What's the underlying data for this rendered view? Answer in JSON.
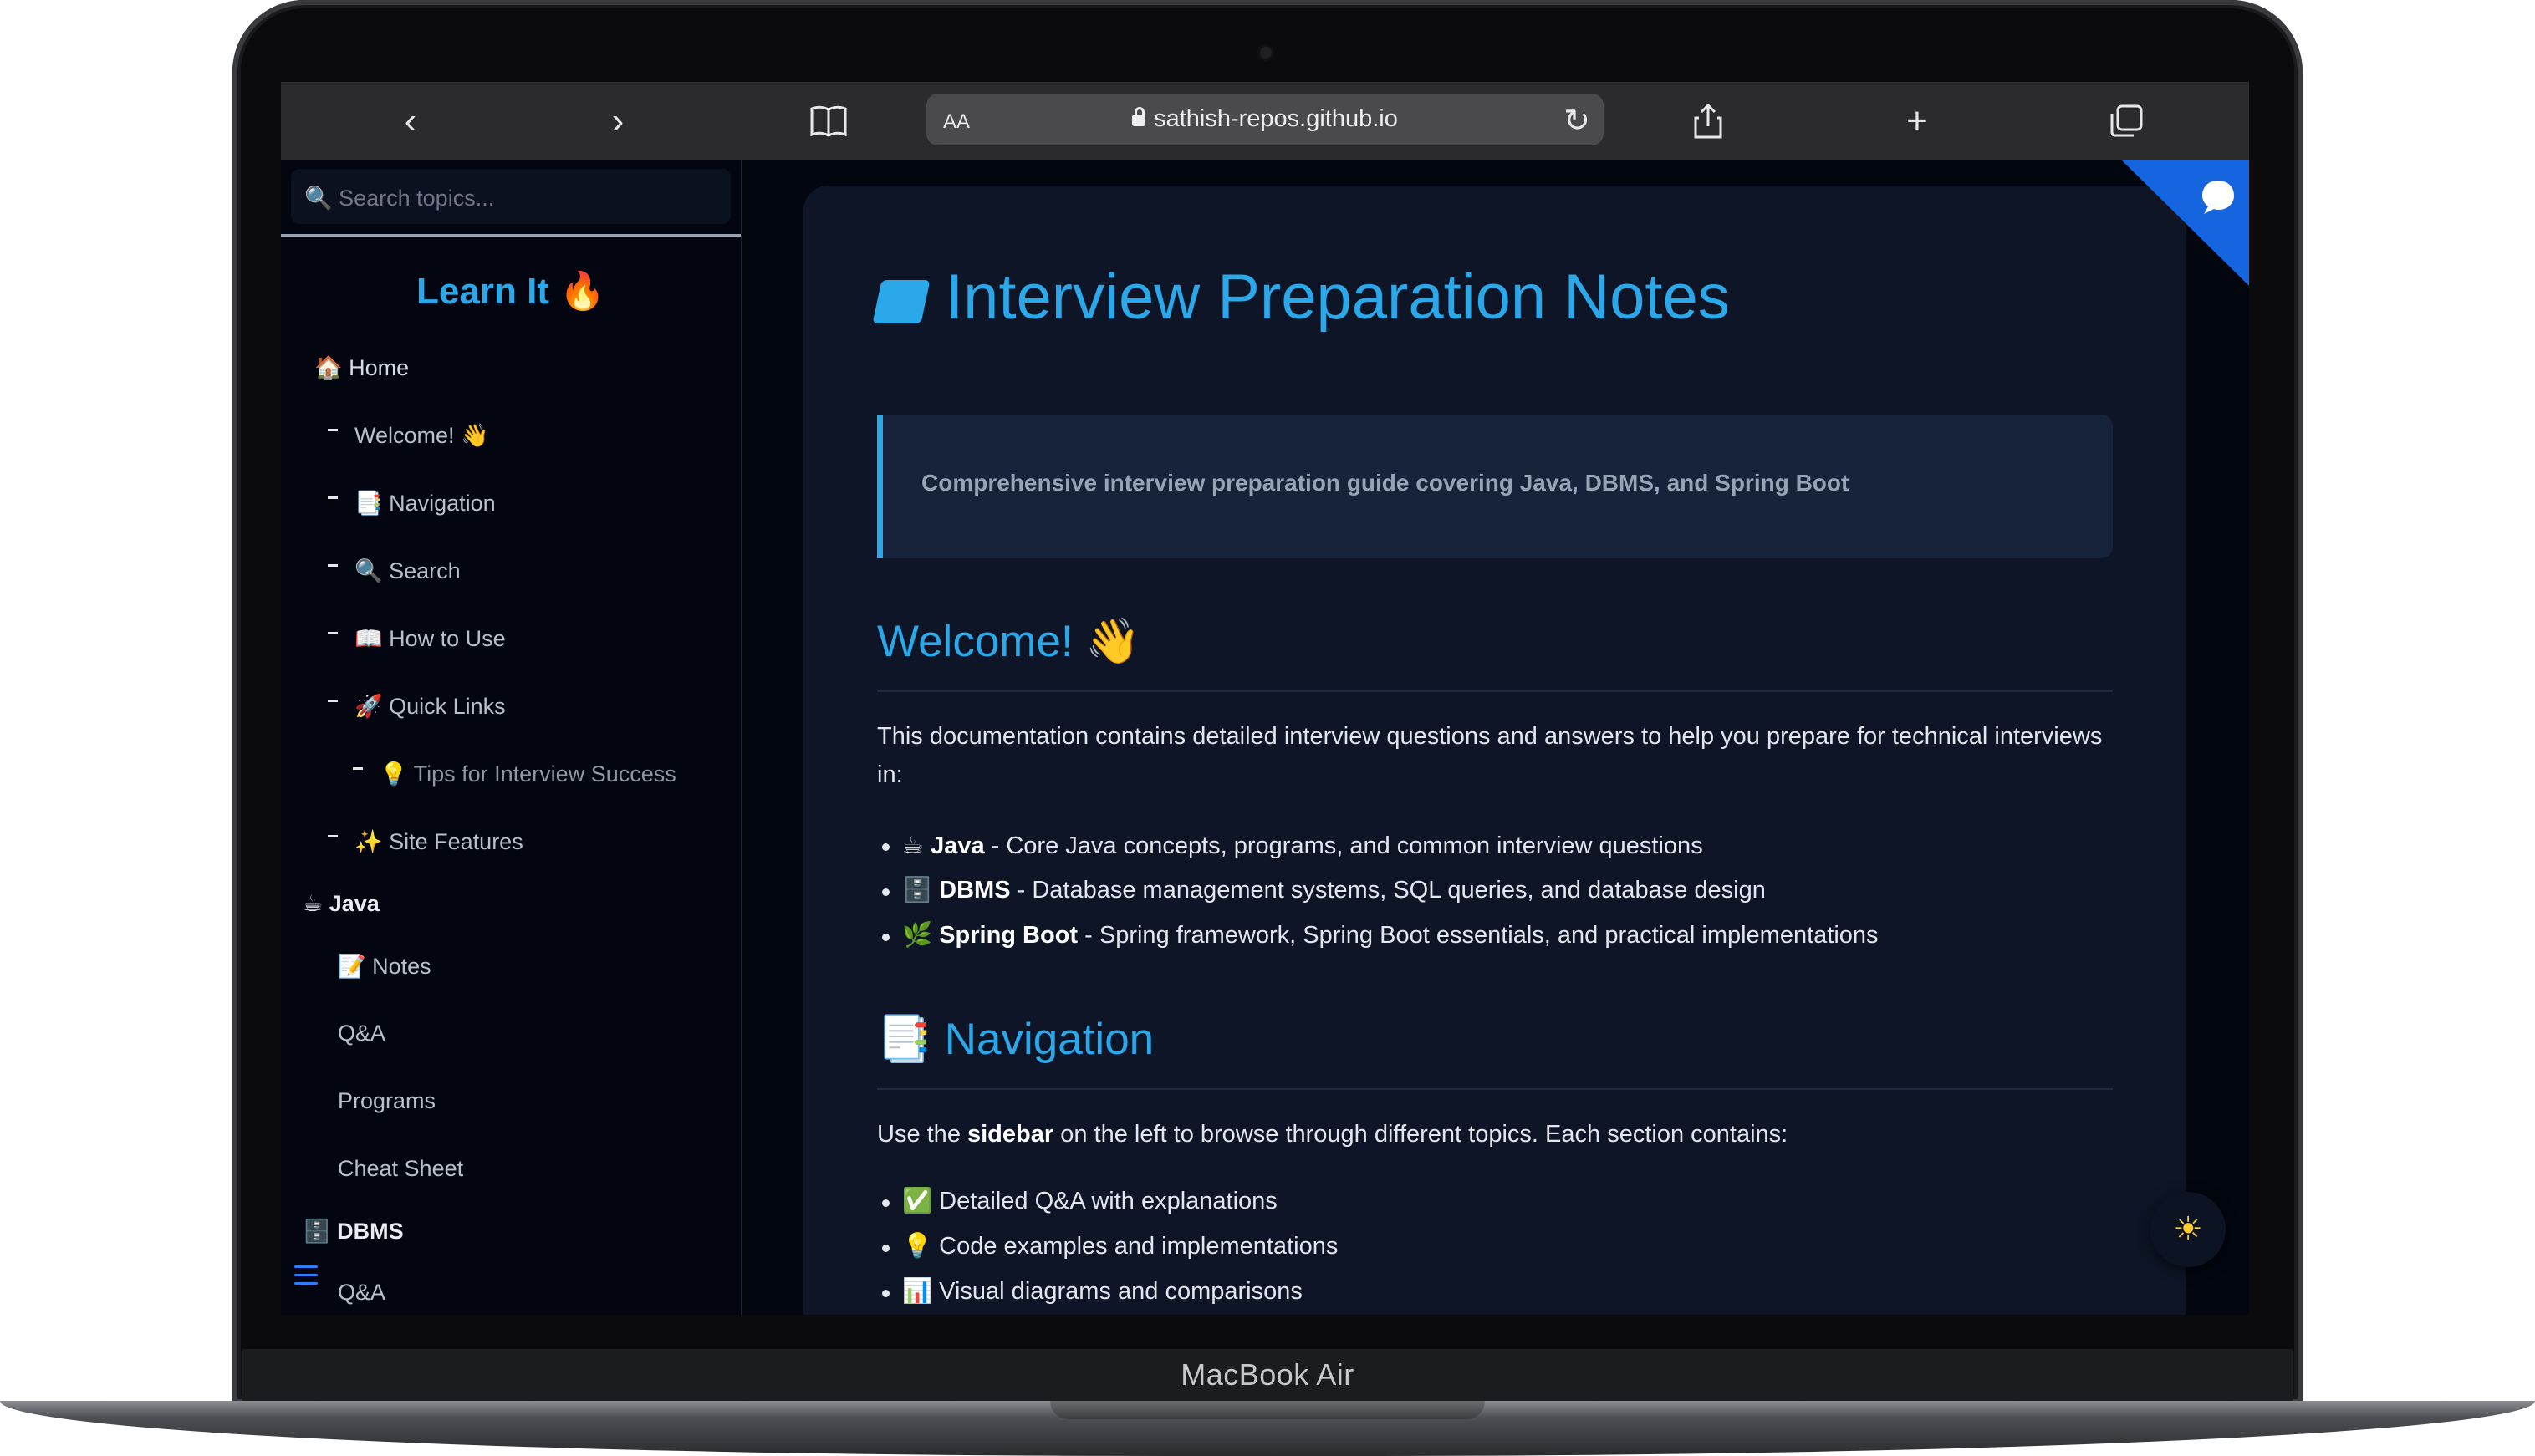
{
  "device": {
    "model_label": "MacBook Air"
  },
  "browser": {
    "text_size_label": "AA",
    "url": "sathish-repos.github.io"
  },
  "sidebar": {
    "search_placeholder": "🔍 Search topics...",
    "brand": "Learn It 🔥",
    "items": [
      {
        "label": "🏠 Home"
      },
      {
        "label": "Welcome! 👋"
      },
      {
        "label": "📑 Navigation"
      },
      {
        "label": "🔍 Search"
      },
      {
        "label": "📖 How to Use"
      },
      {
        "label": "🚀 Quick Links"
      },
      {
        "label": "💡 Tips for Interview Success"
      },
      {
        "label": "✨ Site Features"
      },
      {
        "label": "☕ Java"
      },
      {
        "label": "📝 Notes"
      },
      {
        "label": "Q&A"
      },
      {
        "label": "Programs"
      },
      {
        "label": "Cheat Sheet"
      },
      {
        "label": "🗄️ DBMS"
      },
      {
        "label": "Q&A"
      }
    ]
  },
  "main": {
    "title": "Interview Preparation Notes",
    "callout": "Comprehensive interview preparation guide covering Java, DBMS, and Spring Boot",
    "welcome_heading": "Welcome! 👋",
    "welcome_text": "This documentation contains detailed interview questions and answers to help you prepare for technical interviews in:",
    "topics": [
      {
        "icon": "☕",
        "name": "Java",
        "desc": " - Core Java concepts, programs, and common interview questions"
      },
      {
        "icon": "🗄️",
        "name": "DBMS",
        "desc": " - Database management systems, SQL queries, and database design"
      },
      {
        "icon": "🌿",
        "name": "Spring Boot",
        "desc": " - Spring framework, Spring Boot essentials, and practical implementations"
      }
    ],
    "navigation_heading": "📑 Navigation",
    "nav_text_before": "Use the ",
    "nav_text_bold": "sidebar",
    "nav_text_after": " on the left to browse through different topics. Each section contains:",
    "features": [
      "✅ Detailed Q&A with explanations",
      "💡 Code examples and implementations",
      "📊 Visual diagrams and comparisons"
    ]
  }
}
